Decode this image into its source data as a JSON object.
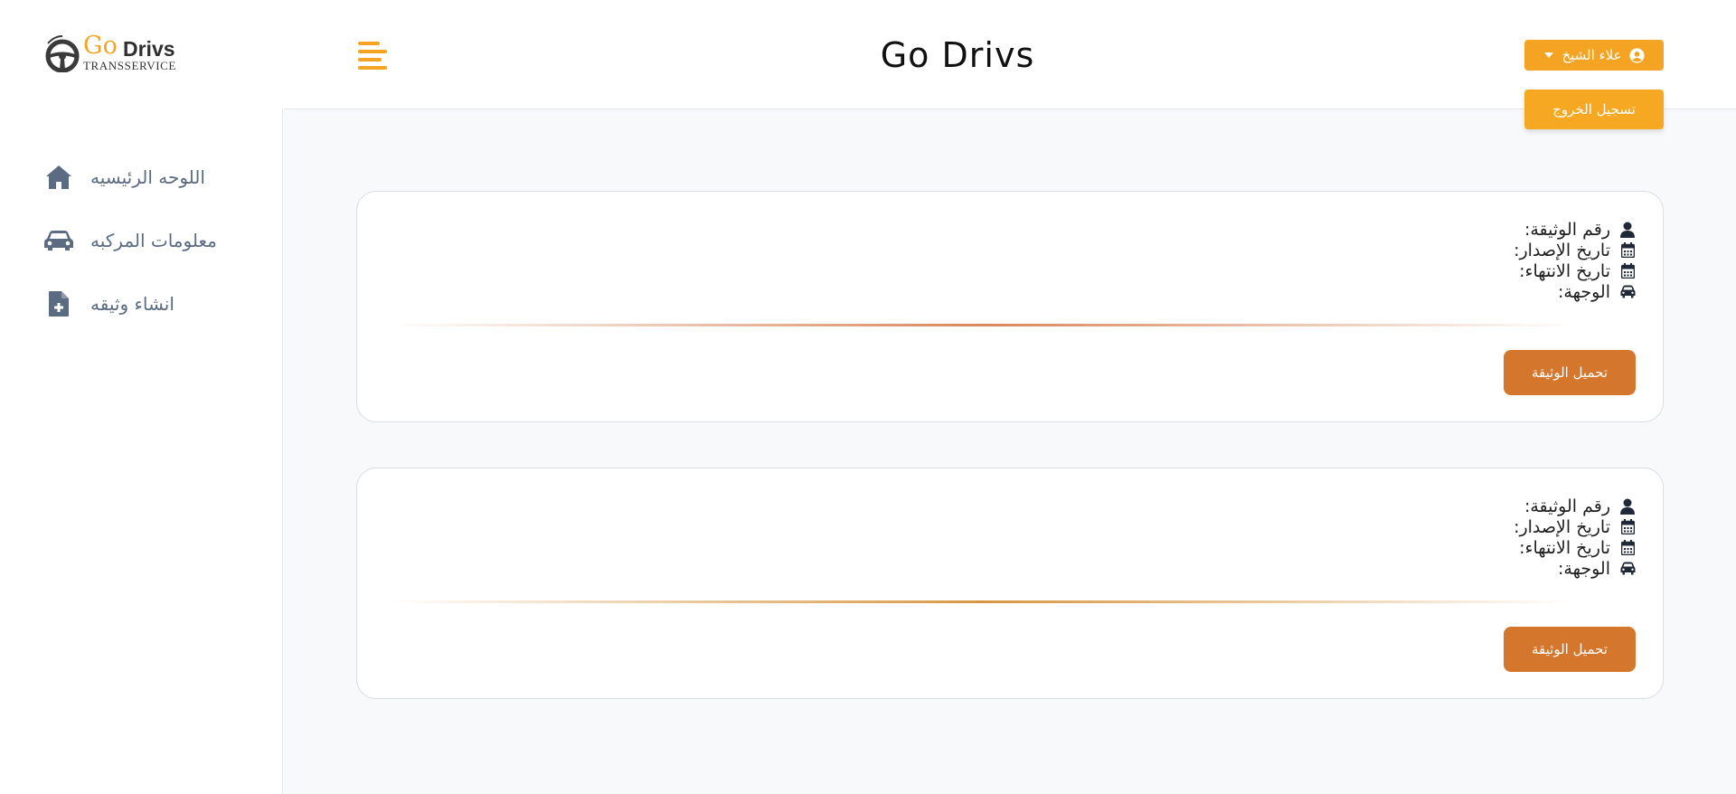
{
  "app": {
    "logo": {
      "word1": "Go",
      "word2": "Drivs",
      "subtitle": "TRANSSERVICE"
    },
    "title": "Go Drivs"
  },
  "header": {
    "user_name": "علاء الشيخ",
    "logout_label": "تسجيل الخروج",
    "icons": {
      "menu": "hamburger-menu-icon",
      "user": "user-circle-icon",
      "caret": "caret-down-icon"
    }
  },
  "sidebar": {
    "items": [
      {
        "label": "اللوحه الرئيسيه",
        "icon": "home-icon"
      },
      {
        "label": "معلومات المركبه",
        "icon": "car-icon"
      },
      {
        "label": "انشاء وثيقه",
        "icon": "file-plus-icon"
      }
    ]
  },
  "cards": [
    {
      "fields": [
        {
          "label": "رقم الوثيقة:",
          "icon": "user-icon"
        },
        {
          "label": "تاريخ الإصدار:",
          "icon": "calendar-icon"
        },
        {
          "label": "تاريخ الانتهاء:",
          "icon": "calendar-icon"
        },
        {
          "label": "الوجهة:",
          "icon": "car-icon"
        }
      ],
      "download_label": "تحميل الوثيقة"
    },
    {
      "fields": [
        {
          "label": "رقم الوثيقة:",
          "icon": "user-icon"
        },
        {
          "label": "تاريخ الإصدار:",
          "icon": "calendar-icon"
        },
        {
          "label": "تاريخ الانتهاء:",
          "icon": "calendar-icon"
        },
        {
          "label": "الوجهة:",
          "icon": "car-icon"
        }
      ],
      "download_label": "تحميل الوثيقة"
    }
  ],
  "colors": {
    "accent": "#f4a422",
    "download": "#d4762c",
    "sidebar_text": "#5b6b82",
    "divider_card1": "#d9875a",
    "divider_card2": "#d79640"
  }
}
